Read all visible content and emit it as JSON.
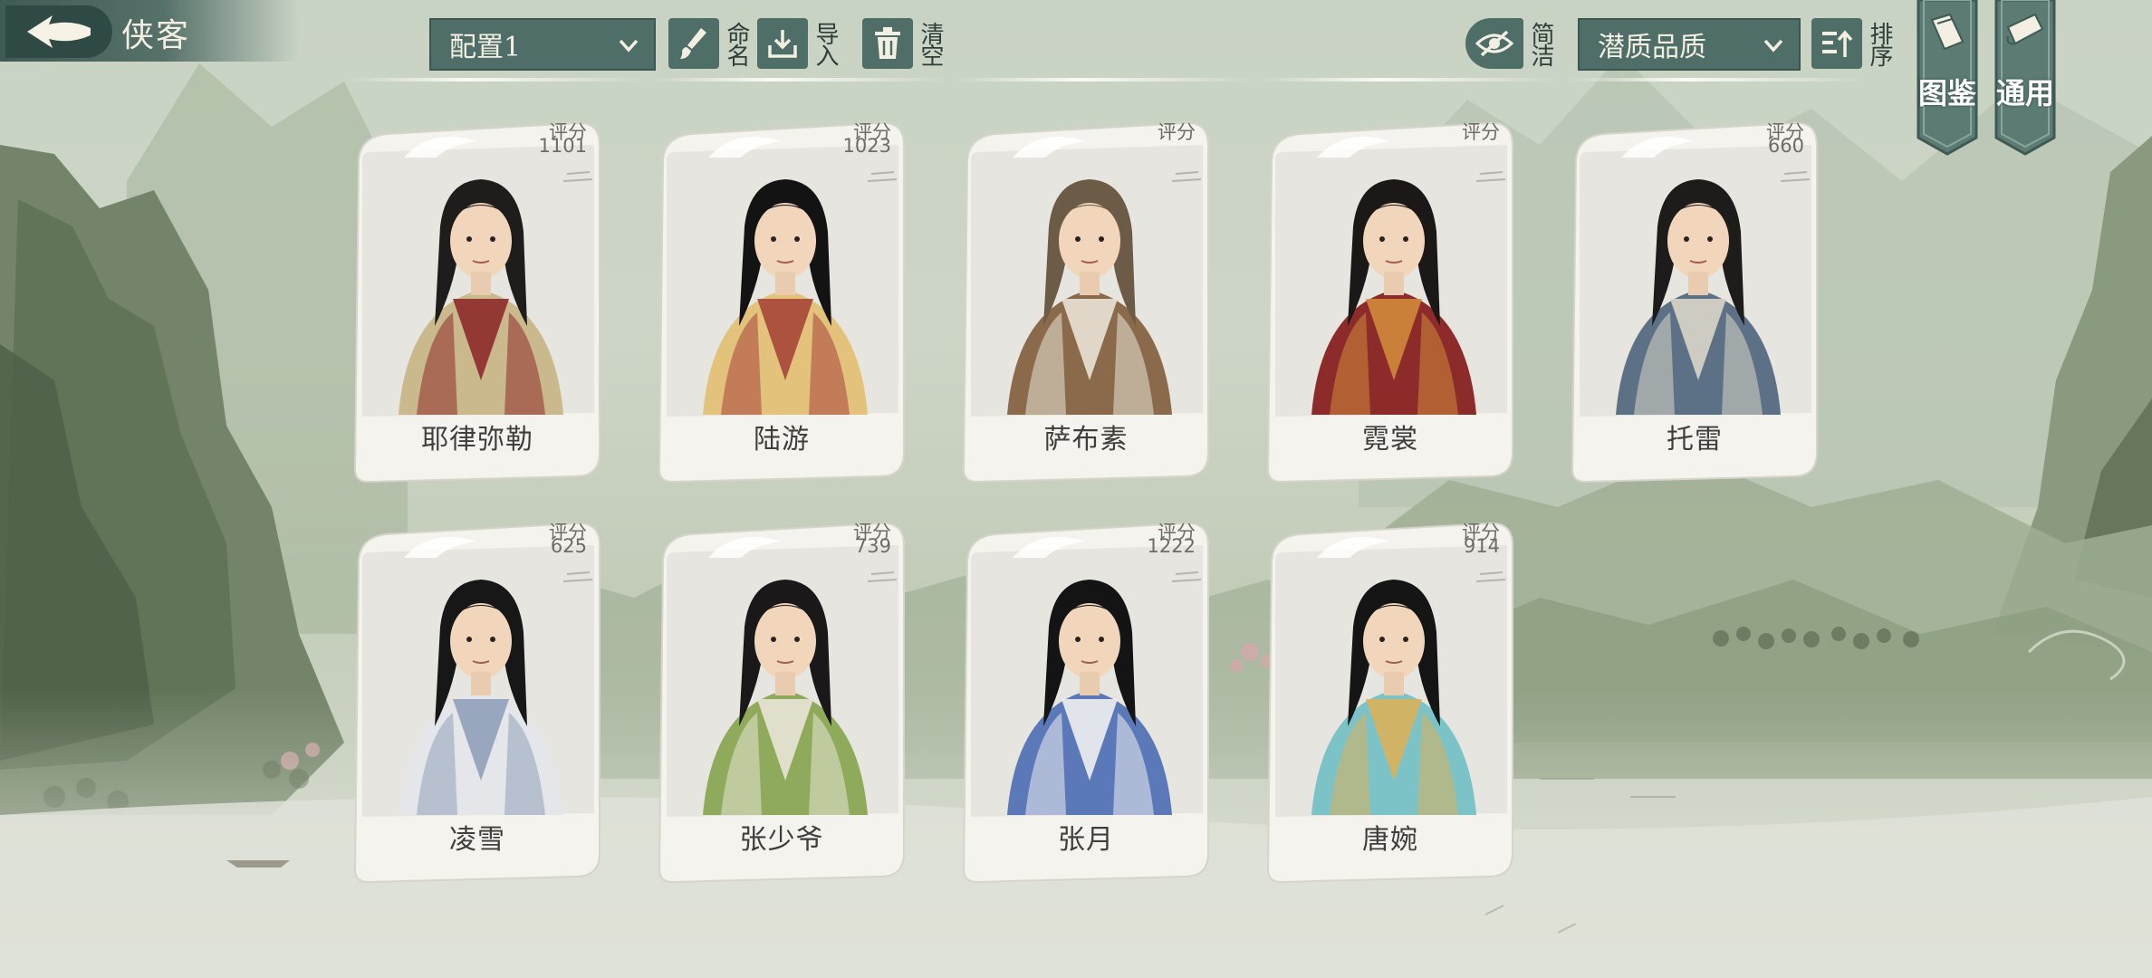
{
  "header": {
    "title": "侠客",
    "config_select": "配置1",
    "rename_label": "命名",
    "import_label": "导入",
    "clear_label": "清空",
    "simple_label": "简洁",
    "sort_select": "潜质品质",
    "sort_label": "排序",
    "codex_label": "图鉴",
    "general_label": "通用"
  },
  "score_label": "评分",
  "heroes": [
    {
      "name": "耶律弥勒",
      "score": "1101",
      "robe": "#c9b98c",
      "accent": "#8e2a2a",
      "hair": "#1f1c1c"
    },
    {
      "name": "陆游",
      "score": "1023",
      "robe": "#e3c27c",
      "accent": "#a7463a",
      "hair": "#141313"
    },
    {
      "name": "萨布素",
      "score": "",
      "robe": "#8b6a4c",
      "accent": "#e9e3d6",
      "hair": "#6c5b47"
    },
    {
      "name": "霓裳",
      "score": "",
      "robe": "#8d2a2a",
      "accent": "#d08a3a",
      "hair": "#1c1818"
    },
    {
      "name": "托雷",
      "score": "660",
      "robe": "#5d7186",
      "accent": "#d9d5c9",
      "hair": "#1e1b1b"
    },
    {
      "name": "凌雪",
      "score": "625",
      "robe": "#e4e6ea",
      "accent": "#8fa0b8",
      "hair": "#171717"
    },
    {
      "name": "张少爷",
      "score": "739",
      "robe": "#8faa5a",
      "accent": "#e8e4d8",
      "hair": "#1a1818"
    },
    {
      "name": "张月",
      "score": "1222",
      "robe": "#5b78b8",
      "accent": "#f0f0f0",
      "hair": "#141414"
    },
    {
      "name": "唐婉",
      "score": "914",
      "robe": "#7cc3c8",
      "accent": "#d9b15a",
      "hair": "#151515"
    }
  ],
  "colors": {
    "ui_teal": "#4f6e67",
    "ui_dark": "#2f4a45",
    "card_bg": "#f4f3ee"
  }
}
